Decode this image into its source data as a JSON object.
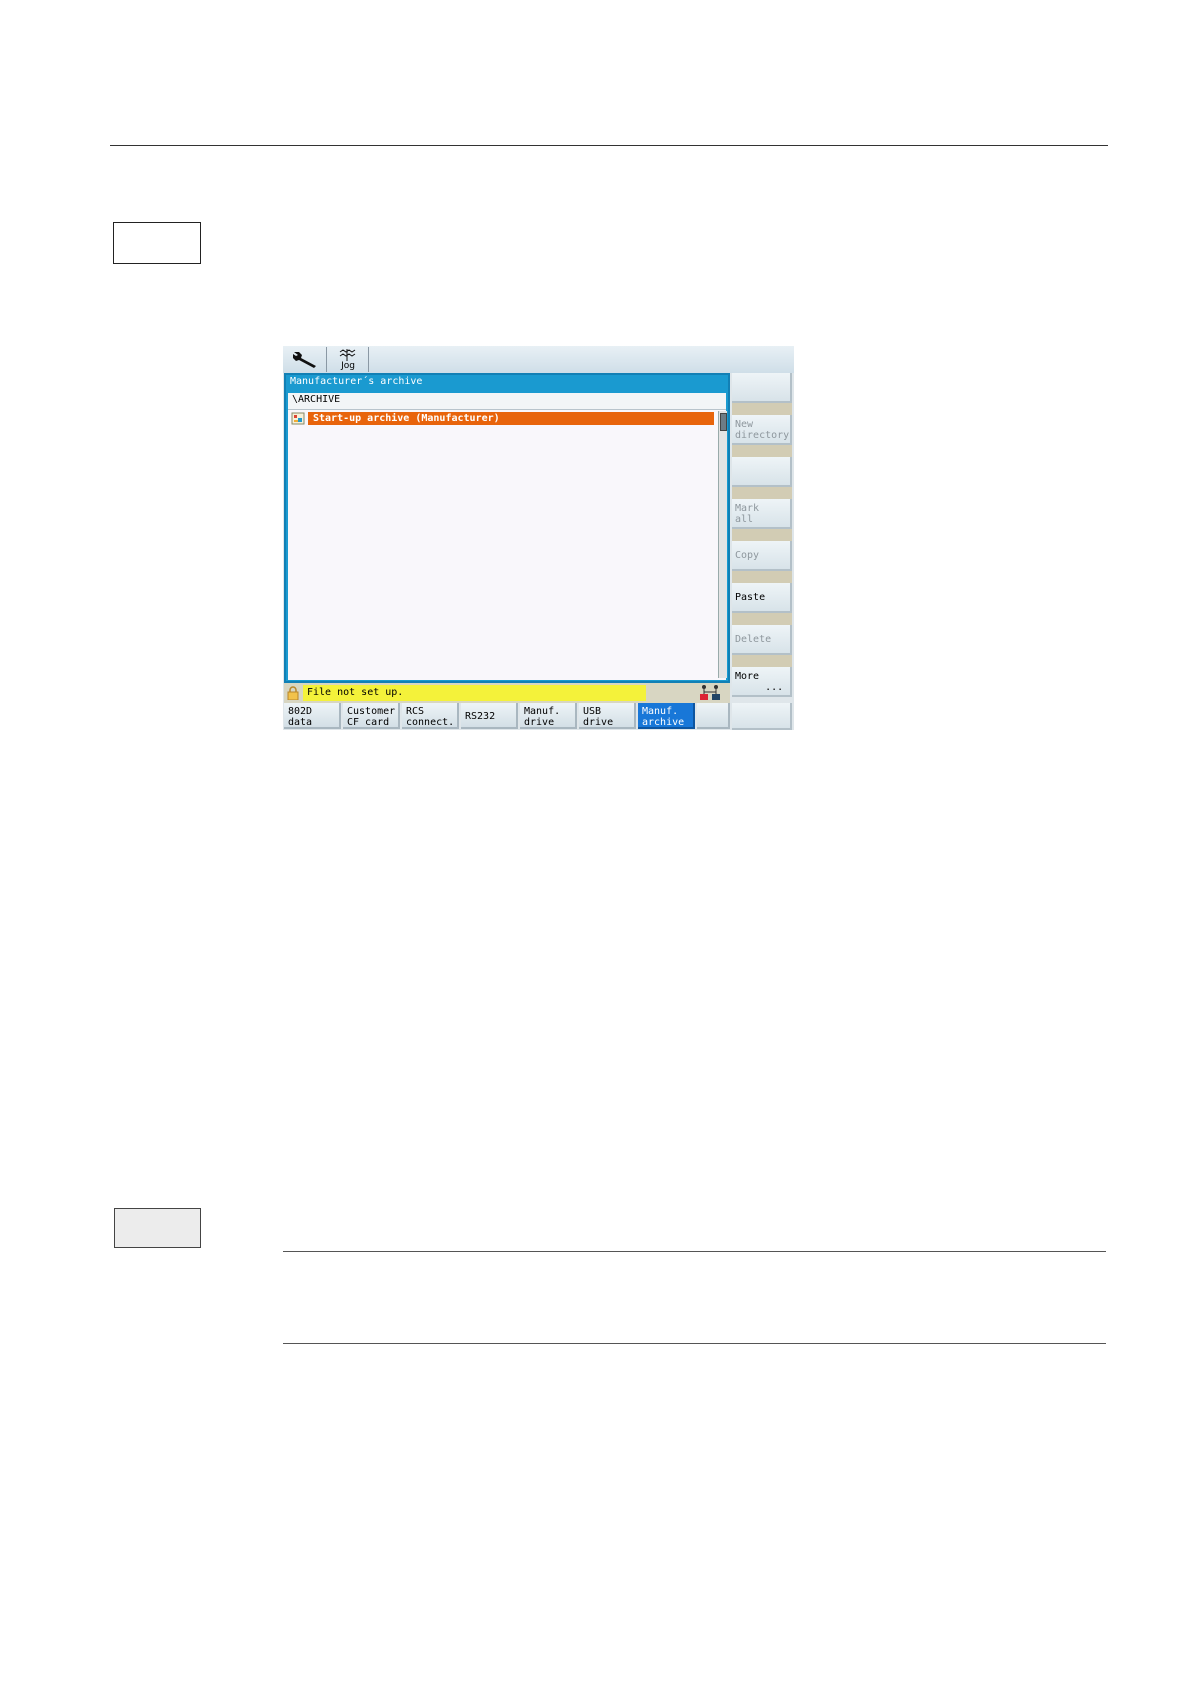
{
  "hmi": {
    "jog_label": "Jog",
    "window_title": "Manufacturer´s archive",
    "path": "\\ARCHIVE",
    "files": [
      {
        "label": "Start-up archive (Manufacturer)",
        "selected": true
      }
    ],
    "status_message": "File not set up.",
    "horizontal_softkeys": [
      {
        "label": "802D\ndata"
      },
      {
        "label": "Customer\nCF card"
      },
      {
        "label": "RCS\nconnect."
      },
      {
        "label": "RS232"
      },
      {
        "label": "Manuf.\ndrive"
      },
      {
        "label": "USB\ndrive"
      },
      {
        "label": "Manuf.\narchive",
        "active": true
      },
      {
        "label": ""
      }
    ],
    "vertical_softkeys": [
      {
        "label": ""
      },
      {
        "label": "New\ndirectory"
      },
      {
        "label": ""
      },
      {
        "label": "Mark\nall"
      },
      {
        "label": "Copy"
      },
      {
        "label": "Paste",
        "enabled": true
      },
      {
        "label": "Delete"
      },
      {
        "label": "More\n     ...",
        "enabled": true
      }
    ],
    "colors": {
      "selection": "#e8640c",
      "frame": "#1a9ad0",
      "status_message_bg": "#f4f23a",
      "active_softkey": "#1877d8"
    }
  }
}
